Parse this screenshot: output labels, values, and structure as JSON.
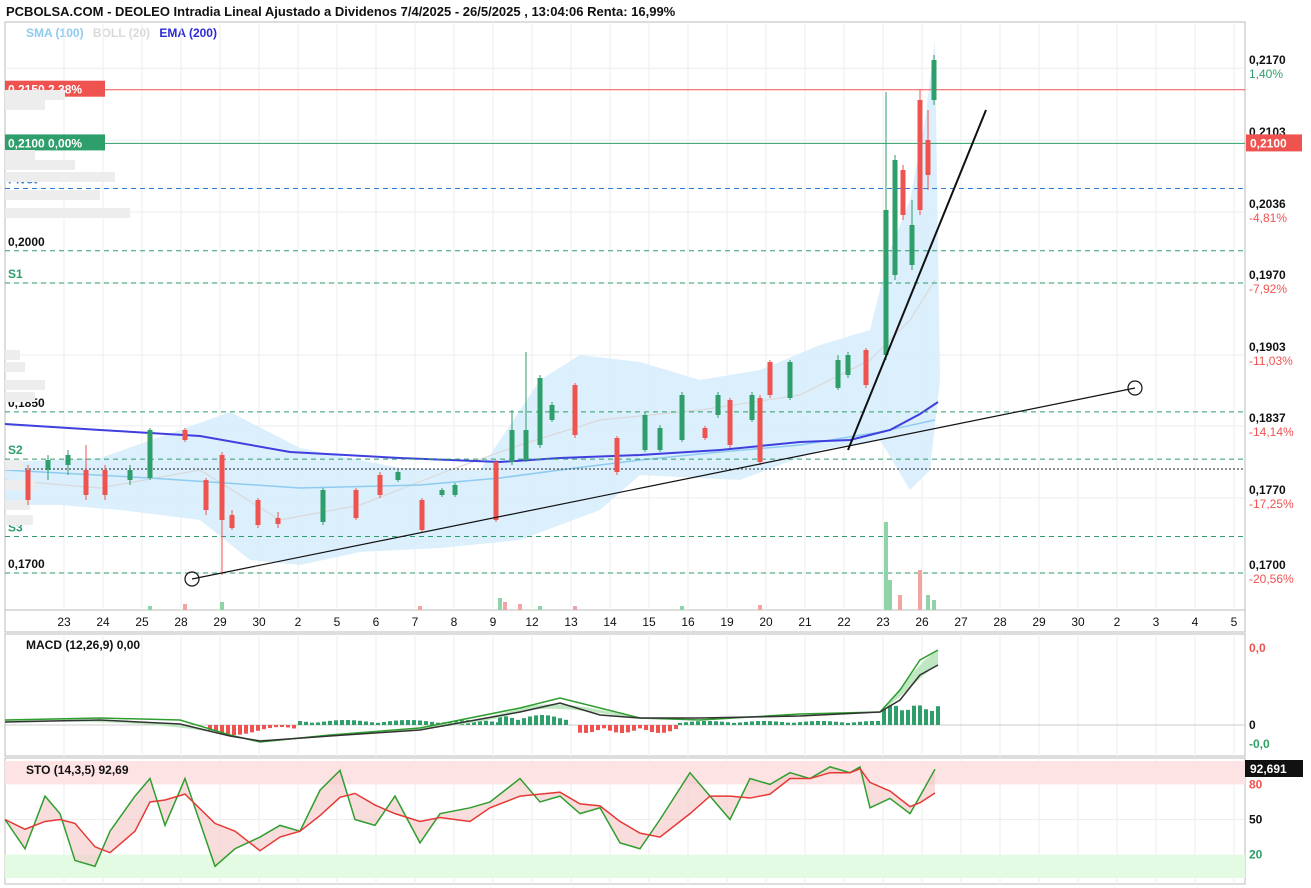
{
  "header": {
    "title": "PCBOLSA.COM - DEOLEO Intradia Lineal Ajustado a Dividenos 7/4/2025 - 26/5/2025 , 13:04:06 Renta: 16,99%",
    "legend": [
      {
        "label": "SMA (100)",
        "color": "#8ecbf0"
      },
      {
        "label": "BOLL (20)",
        "color": "#d9d9d9"
      },
      {
        "label": "EMA (200)",
        "color": "#2b2bd6"
      }
    ]
  },
  "colors": {
    "up": "#2e9e6a",
    "down": "#ef5350",
    "band": "#d6ecfb",
    "ema": "#3f3fe0",
    "sma": "#8ecbf0",
    "boll": "#d9d9d9",
    "grid": "#eeeeee"
  },
  "price_levels": [
    {
      "label": "0,2150  2,38%",
      "value": 0.215,
      "bg": "#ef5350",
      "line": "#ef5350",
      "style": "solid"
    },
    {
      "label": "0,2100  0,00%",
      "value": 0.21,
      "bg": "#2e9e6a",
      "line": "#2e9e6a",
      "style": "solid"
    },
    {
      "label": "Pivot",
      "value": 0.2058,
      "color": "#2f7bd6",
      "line": "#2f7bd6",
      "style": "dashed"
    },
    {
      "label": "0,2000",
      "value": 0.2,
      "color": "#111",
      "line": "#2e9e6a",
      "style": "dashed"
    },
    {
      "label": "S1",
      "value": 0.197,
      "color": "#2e9e6a",
      "line": "#2e9e6a",
      "style": "dashed"
    },
    {
      "label": "0,1850",
      "value": 0.185,
      "color": "#111",
      "line": "#2e9e6a",
      "style": "dashed"
    },
    {
      "label": "S2",
      "value": 0.1806,
      "color": "#2e9e6a",
      "line": "#2e9e6a",
      "style": "dashed"
    },
    {
      "label": "S3",
      "value": 0.1734,
      "color": "#2e9e6a",
      "line": "#2e9e6a",
      "style": "dashed"
    },
    {
      "label": "0,1700",
      "value": 0.17,
      "color": "#111",
      "line": "#2e9e6a",
      "style": "dashed"
    }
  ],
  "right_axis": [
    {
      "price": "0,2170",
      "pct": "1,40%",
      "pct_color": "#2e9e6a"
    },
    {
      "price": "0,2103",
      "pct": "",
      "pct_color": "#111"
    },
    {
      "price": "0,2036",
      "pct": "-4,81%",
      "pct_color": "#ef5350"
    },
    {
      "price": "0,1970",
      "pct": "-7,92%",
      "pct_color": "#ef5350"
    },
    {
      "price": "0,1903",
      "pct": "-11,03%",
      "pct_color": "#ef5350"
    },
    {
      "price": "0,1837",
      "pct": "-14,14%",
      "pct_color": "#ef5350"
    },
    {
      "price": "0,1770",
      "pct": "-17,25%",
      "pct_color": "#ef5350"
    },
    {
      "price": "0,1700",
      "pct": "-20,56%",
      "pct_color": "#ef5350"
    }
  ],
  "last_price_tag": "0,2100",
  "x_axis": [
    "23",
    "24",
    "25",
    "28",
    "29",
    "30",
    "2",
    "5",
    "6",
    "7",
    "8",
    "9",
    "12",
    "13",
    "14",
    "15",
    "16",
    "19",
    "20",
    "21",
    "22",
    "23",
    "26",
    "27",
    "28",
    "29",
    "30",
    "2",
    "3",
    "4",
    "5"
  ],
  "macd": {
    "label": "MACD (12,26,9)   0,00",
    "ticks": [
      "0,0",
      "0",
      "-0,0"
    ]
  },
  "sto": {
    "label": "STO (14,3,5)    92,69",
    "last": "92,691",
    "ticks": [
      "80",
      "50",
      "20"
    ]
  },
  "chart_data": [
    {
      "type": "candlestick",
      "title": "PCBOLSA.COM - DEOLEO Intradia Lineal Ajustado a Dividenos 7/4/2025 - 26/5/2025 , 13:04:06 Renta: 16,99%",
      "categories": [
        "23",
        "24",
        "25",
        "28",
        "29",
        "30",
        "2",
        "5",
        "6",
        "7",
        "8",
        "9",
        "12",
        "13",
        "14",
        "15",
        "16",
        "19",
        "20",
        "21",
        "22",
        "23",
        "26"
      ],
      "close": [
        0.179,
        0.1795,
        0.181,
        0.178,
        0.174,
        0.1745,
        0.176,
        0.177,
        0.1778,
        0.1775,
        0.178,
        0.18,
        0.184,
        0.1845,
        0.1808,
        0.1815,
        0.183,
        0.184,
        0.185,
        0.1895,
        0.19,
        0.203,
        0.215
      ],
      "ylim": [
        0.168,
        0.219
      ],
      "overlays": [
        "SMA (100)",
        "BOLL (20)",
        "EMA (200)"
      ]
    },
    {
      "type": "bar",
      "name": "MACD (12,26,9)",
      "value": 0.0
    },
    {
      "type": "line",
      "name": "STO (14,3,5)",
      "value": 92.69,
      "ylim": [
        0,
        100
      ]
    }
  ]
}
